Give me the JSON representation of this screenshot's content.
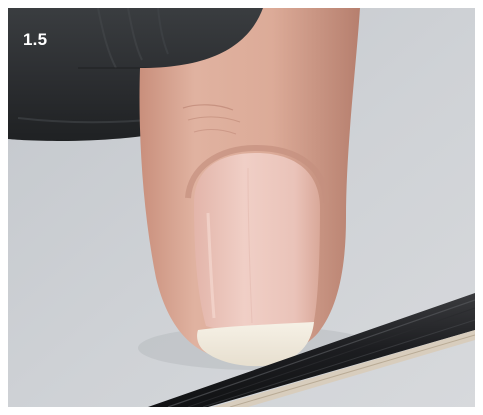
{
  "photo": {
    "step_label": "1.5",
    "subject": "finger-with-nail-file",
    "colors": {
      "background": "#c9cdd2",
      "glove": "#2b2e31",
      "skin": "#d9a895",
      "nail": "#ecc7bf",
      "nail_tip": "#f1ecdf",
      "file": "#1e1f22"
    }
  }
}
